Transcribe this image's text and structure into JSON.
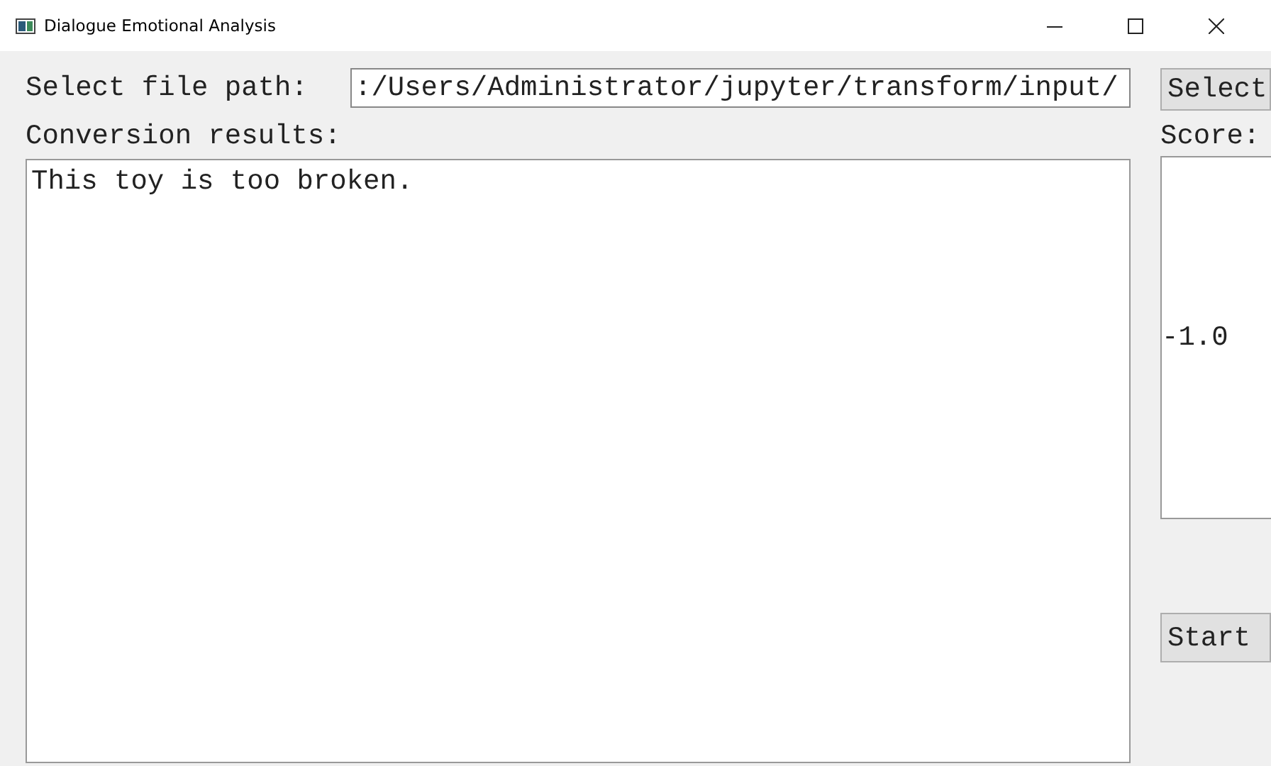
{
  "window": {
    "title": "Dialogue Emotional Analysis"
  },
  "file_path": {
    "label": "Select file path:",
    "value": ":/Users/Administrator/jupyter/transform/input/",
    "button": "Select"
  },
  "results": {
    "label": "Conversion results:",
    "value": "This toy is too broken."
  },
  "score": {
    "label": "Score:",
    "value": "-1.0"
  },
  "start_button": "Start"
}
